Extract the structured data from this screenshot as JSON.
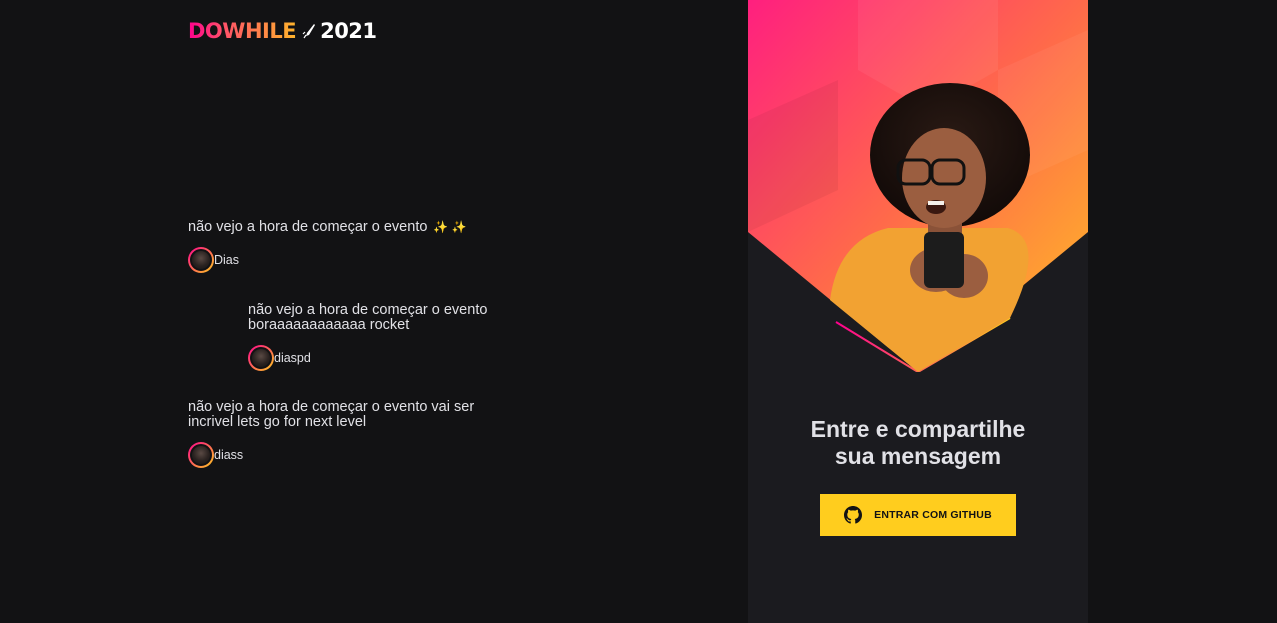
{
  "logo": {
    "part_do": "DO",
    "part_while": "WHILE",
    "year": "2021",
    "icon": "rocket-icon"
  },
  "messages": [
    {
      "text": "não vejo a hora de começar o evento",
      "emoji": "✨ ✨",
      "user": "Dias"
    },
    {
      "text": "não vejo a hora de começar o evento boraaaaaaaaaaaa rocket",
      "user": "diaspd"
    },
    {
      "text": "não vejo a hora de começar o evento vai ser incrivel lets go for next level",
      "user": "diass"
    }
  ],
  "login_panel": {
    "title_line1": "Entre e compartilhe",
    "title_line2": "sua mensagem",
    "button_label": "ENTRAR COM GITHUB",
    "button_icon": "github-icon"
  },
  "colors": {
    "background": "#121214",
    "panel": "#1b1b1f",
    "accent_pink": "#ff008e",
    "accent_yellow": "#ffcd1e",
    "text": "#e1e1e6"
  }
}
